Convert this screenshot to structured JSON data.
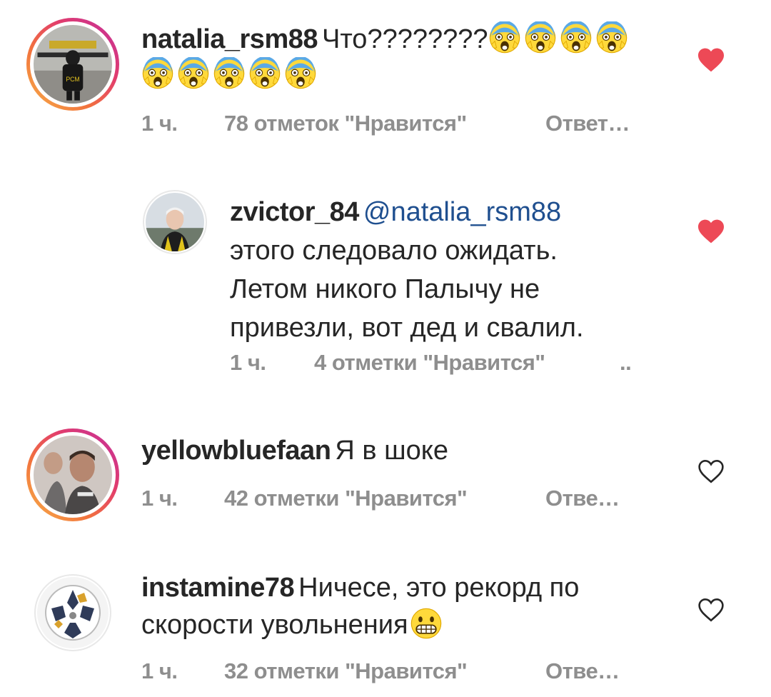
{
  "comments": [
    {
      "username": "natalia_rsm88",
      "text": "Что????????",
      "emoji_icon": "fearful-scream-emoji",
      "emoji_count": 9,
      "time": "1 ч.",
      "likes": "78 отметок \"Нравится\"",
      "reply": "Ответ…",
      "liked": true
    },
    {
      "username": "zvictor_84",
      "mention": "@natalia_rsm88",
      "lines": [
        "этого следовало ожидать.",
        "Летом никого Палычу не",
        "привезли, вот дед и свалил."
      ],
      "time": "1 ч.",
      "likes": "4 отметки \"Нравится\"",
      "reply": "..",
      "liked": true
    },
    {
      "username": "yellowbluefaan",
      "text": "Я в шоке",
      "time": "1 ч.",
      "likes": "42 отметки \"Нравится\"",
      "reply": "Отве…",
      "liked": false
    },
    {
      "username": "instamine78",
      "text": "Ничесе, это рекорд по",
      "text2": "скорости увольнения",
      "emoji_icon": "grimacing-face-emoji",
      "time": "1 ч.",
      "likes": "32 отметки \"Нравится\"",
      "reply": "Отве…",
      "liked": false
    }
  ],
  "colors": {
    "heart_filled": "#ed4956",
    "meta_text": "#8e8e8e",
    "mention": "#1f4f8f"
  }
}
